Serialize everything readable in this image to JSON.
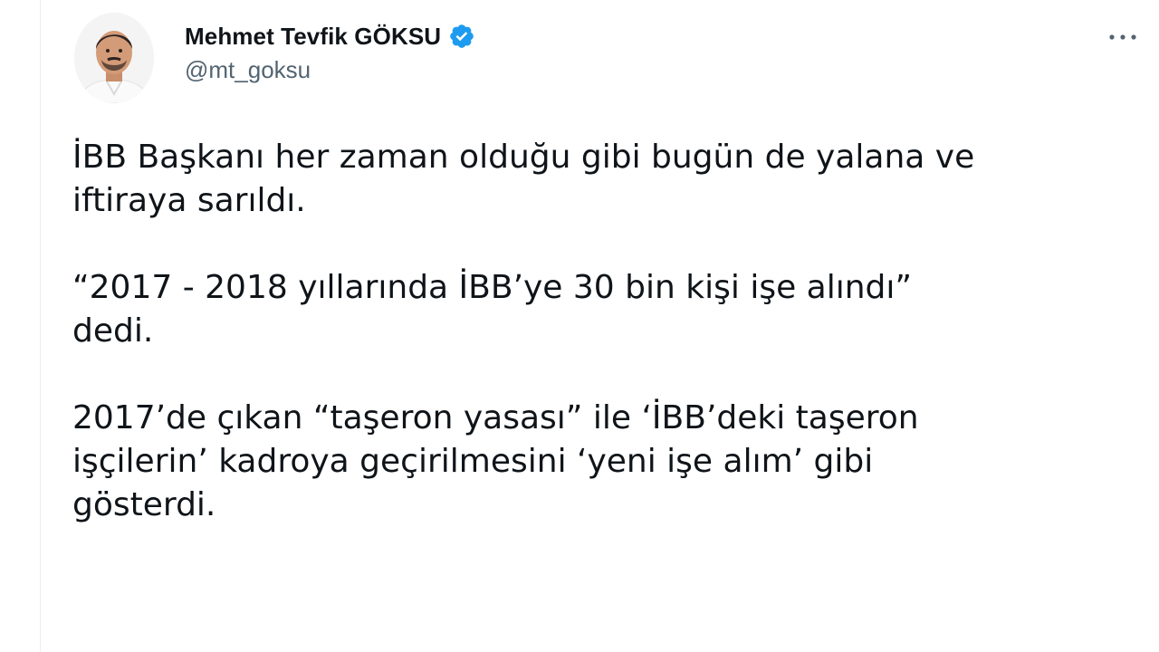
{
  "tweet": {
    "author": {
      "display_name": "Mehmet Tevfik GÖKSU",
      "handle": "@mt_goksu",
      "verified": true,
      "avatar_icon": "profile-photo",
      "verified_icon": "verified-badge-icon"
    },
    "more_icon": "more-options-icon",
    "body": [
      "İBB Başkanı her zaman olduğu gibi bugün de yalana ve\niftiraya sarıldı.",
      "“2017 - 2018 yıllarında İBB’ye 30 bin kişi işe alındı”\ndedi.",
      "2017’de çıkan “taşeron yasası” ile ‘İBB’deki taşeron\nişçilerin’ kadroya geçirilmesini ‘yeni işe alım’ gibi\ngösterdi."
    ]
  },
  "colors": {
    "text_primary": "#0f1419",
    "text_secondary": "#536471",
    "verified_blue": "#1d9bf0",
    "background": "#ffffff"
  }
}
